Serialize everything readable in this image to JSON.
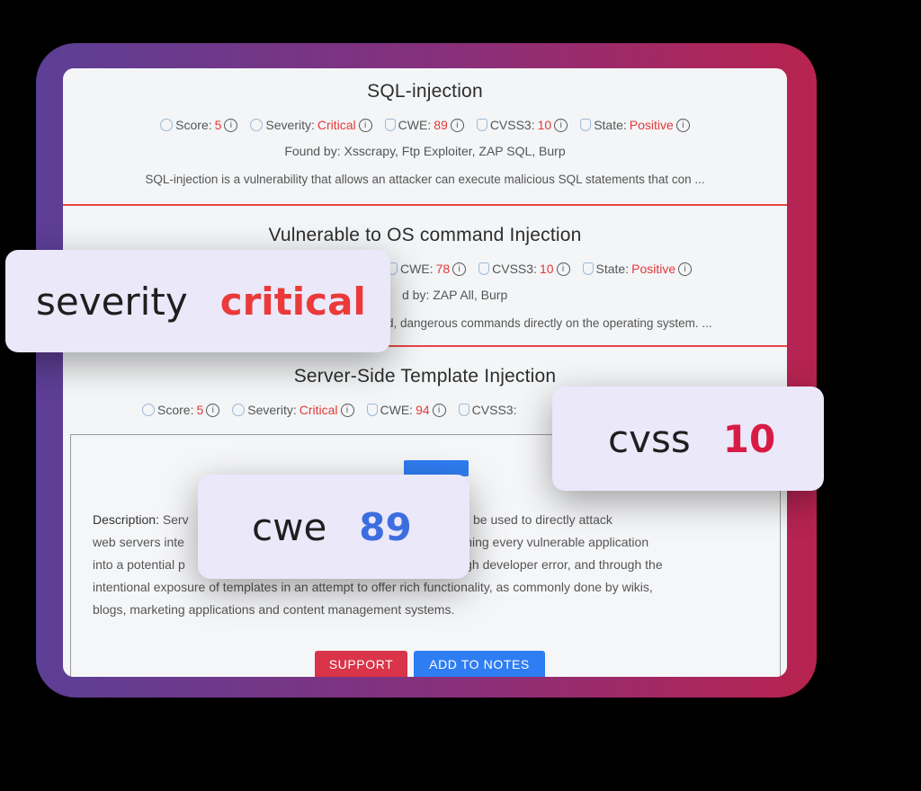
{
  "vulnerabilities": [
    {
      "title": "SQL-injection",
      "score_label": "Score:",
      "score": "5",
      "severity_label": "Severity:",
      "severity": "Critical",
      "cwe_label": "CWE:",
      "cwe": "89",
      "cvss_label": "CVSS3:",
      "cvss": "10",
      "state_label": "State:",
      "state": "Positive",
      "found_by": "Found by: Xsscrapy, Ftp Exploiter, ZAP SQL, Burp",
      "description": "SQL-injection is a vulnerability that allows an attacker can execute malicious SQL statements that con ..."
    },
    {
      "title": "Vulnerable to OS command Injection",
      "cwe_label": "CWE:",
      "cwe": "78",
      "cvss_label": "CVSS3:",
      "cvss": "10",
      "state_label": "State:",
      "state": "Positive",
      "found_by": "d by: ZAP All, Burp",
      "description": "d, dangerous commands directly on the operating system. ..."
    },
    {
      "title": "Server-Side Template Injection",
      "score_label": "Score:",
      "score": "5",
      "severity_label": "Severity:",
      "severity": "Critical",
      "cwe_label": "CWE:",
      "cwe": "94",
      "cvss_label": "CVSS3:"
    }
  ],
  "detail": {
    "description_label": "Description:",
    "line1_a": "Serv",
    "line1_b": "nerability that can be used to directly attack",
    "line2_a": "web servers inte",
    "line2_b": "ution, turning every vulnerable application",
    "line3_a": "into a potential p",
    "line3_b": "h through developer error, and through the",
    "line4": "intentional exposure of templates in an attempt to offer rich functionality, as commonly done by wikis,",
    "line5": "blogs, marketing applications and content management systems."
  },
  "buttons": {
    "support": "SUPPORT",
    "add_to_notes": "ADD TO NOTES"
  },
  "callouts": {
    "severity_label": "severity",
    "severity_value": "critical",
    "cvss_label": "cvss",
    "cvss_value": "10",
    "cwe_label": "cwe",
    "cwe_value": "89"
  },
  "colors": {
    "critical": "#e53838",
    "blue_value": "#3d6ee0",
    "cvss_value": "#d81b45"
  }
}
